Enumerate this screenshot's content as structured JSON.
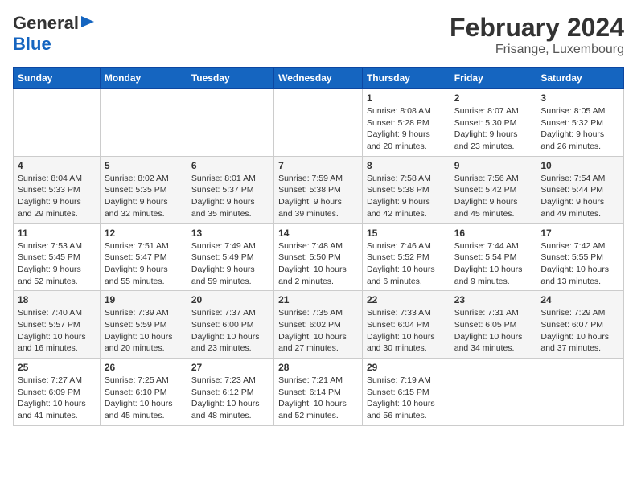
{
  "logo": {
    "line1": "General",
    "line2": "Blue"
  },
  "title": "February 2024",
  "subtitle": "Frisange, Luxembourg",
  "days_header": [
    "Sunday",
    "Monday",
    "Tuesday",
    "Wednesday",
    "Thursday",
    "Friday",
    "Saturday"
  ],
  "weeks": [
    [
      {
        "day": "",
        "info": ""
      },
      {
        "day": "",
        "info": ""
      },
      {
        "day": "",
        "info": ""
      },
      {
        "day": "",
        "info": ""
      },
      {
        "day": "1",
        "info": "Sunrise: 8:08 AM\nSunset: 5:28 PM\nDaylight: 9 hours\nand 20 minutes."
      },
      {
        "day": "2",
        "info": "Sunrise: 8:07 AM\nSunset: 5:30 PM\nDaylight: 9 hours\nand 23 minutes."
      },
      {
        "day": "3",
        "info": "Sunrise: 8:05 AM\nSunset: 5:32 PM\nDaylight: 9 hours\nand 26 minutes."
      }
    ],
    [
      {
        "day": "4",
        "info": "Sunrise: 8:04 AM\nSunset: 5:33 PM\nDaylight: 9 hours\nand 29 minutes."
      },
      {
        "day": "5",
        "info": "Sunrise: 8:02 AM\nSunset: 5:35 PM\nDaylight: 9 hours\nand 32 minutes."
      },
      {
        "day": "6",
        "info": "Sunrise: 8:01 AM\nSunset: 5:37 PM\nDaylight: 9 hours\nand 35 minutes."
      },
      {
        "day": "7",
        "info": "Sunrise: 7:59 AM\nSunset: 5:38 PM\nDaylight: 9 hours\nand 39 minutes."
      },
      {
        "day": "8",
        "info": "Sunrise: 7:58 AM\nSunset: 5:38 PM\nDaylight: 9 hours\nand 42 minutes."
      },
      {
        "day": "9",
        "info": "Sunrise: 7:56 AM\nSunset: 5:42 PM\nDaylight: 9 hours\nand 45 minutes."
      },
      {
        "day": "10",
        "info": "Sunrise: 7:54 AM\nSunset: 5:44 PM\nDaylight: 9 hours\nand 49 minutes."
      }
    ],
    [
      {
        "day": "11",
        "info": "Sunrise: 7:53 AM\nSunset: 5:45 PM\nDaylight: 9 hours\nand 52 minutes."
      },
      {
        "day": "12",
        "info": "Sunrise: 7:51 AM\nSunset: 5:47 PM\nDaylight: 9 hours\nand 55 minutes."
      },
      {
        "day": "13",
        "info": "Sunrise: 7:49 AM\nSunset: 5:49 PM\nDaylight: 9 hours\nand 59 minutes."
      },
      {
        "day": "14",
        "info": "Sunrise: 7:48 AM\nSunset: 5:50 PM\nDaylight: 10 hours\nand 2 minutes."
      },
      {
        "day": "15",
        "info": "Sunrise: 7:46 AM\nSunset: 5:52 PM\nDaylight: 10 hours\nand 6 minutes."
      },
      {
        "day": "16",
        "info": "Sunrise: 7:44 AM\nSunset: 5:54 PM\nDaylight: 10 hours\nand 9 minutes."
      },
      {
        "day": "17",
        "info": "Sunrise: 7:42 AM\nSunset: 5:55 PM\nDaylight: 10 hours\nand 13 minutes."
      }
    ],
    [
      {
        "day": "18",
        "info": "Sunrise: 7:40 AM\nSunset: 5:57 PM\nDaylight: 10 hours\nand 16 minutes."
      },
      {
        "day": "19",
        "info": "Sunrise: 7:39 AM\nSunset: 5:59 PM\nDaylight: 10 hours\nand 20 minutes."
      },
      {
        "day": "20",
        "info": "Sunrise: 7:37 AM\nSunset: 6:00 PM\nDaylight: 10 hours\nand 23 minutes."
      },
      {
        "day": "21",
        "info": "Sunrise: 7:35 AM\nSunset: 6:02 PM\nDaylight: 10 hours\nand 27 minutes."
      },
      {
        "day": "22",
        "info": "Sunrise: 7:33 AM\nSunset: 6:04 PM\nDaylight: 10 hours\nand 30 minutes."
      },
      {
        "day": "23",
        "info": "Sunrise: 7:31 AM\nSunset: 6:05 PM\nDaylight: 10 hours\nand 34 minutes."
      },
      {
        "day": "24",
        "info": "Sunrise: 7:29 AM\nSunset: 6:07 PM\nDaylight: 10 hours\nand 37 minutes."
      }
    ],
    [
      {
        "day": "25",
        "info": "Sunrise: 7:27 AM\nSunset: 6:09 PM\nDaylight: 10 hours\nand 41 minutes."
      },
      {
        "day": "26",
        "info": "Sunrise: 7:25 AM\nSunset: 6:10 PM\nDaylight: 10 hours\nand 45 minutes."
      },
      {
        "day": "27",
        "info": "Sunrise: 7:23 AM\nSunset: 6:12 PM\nDaylight: 10 hours\nand 48 minutes."
      },
      {
        "day": "28",
        "info": "Sunrise: 7:21 AM\nSunset: 6:14 PM\nDaylight: 10 hours\nand 52 minutes."
      },
      {
        "day": "29",
        "info": "Sunrise: 7:19 AM\nSunset: 6:15 PM\nDaylight: 10 hours\nand 56 minutes."
      },
      {
        "day": "",
        "info": ""
      },
      {
        "day": "",
        "info": ""
      }
    ]
  ]
}
